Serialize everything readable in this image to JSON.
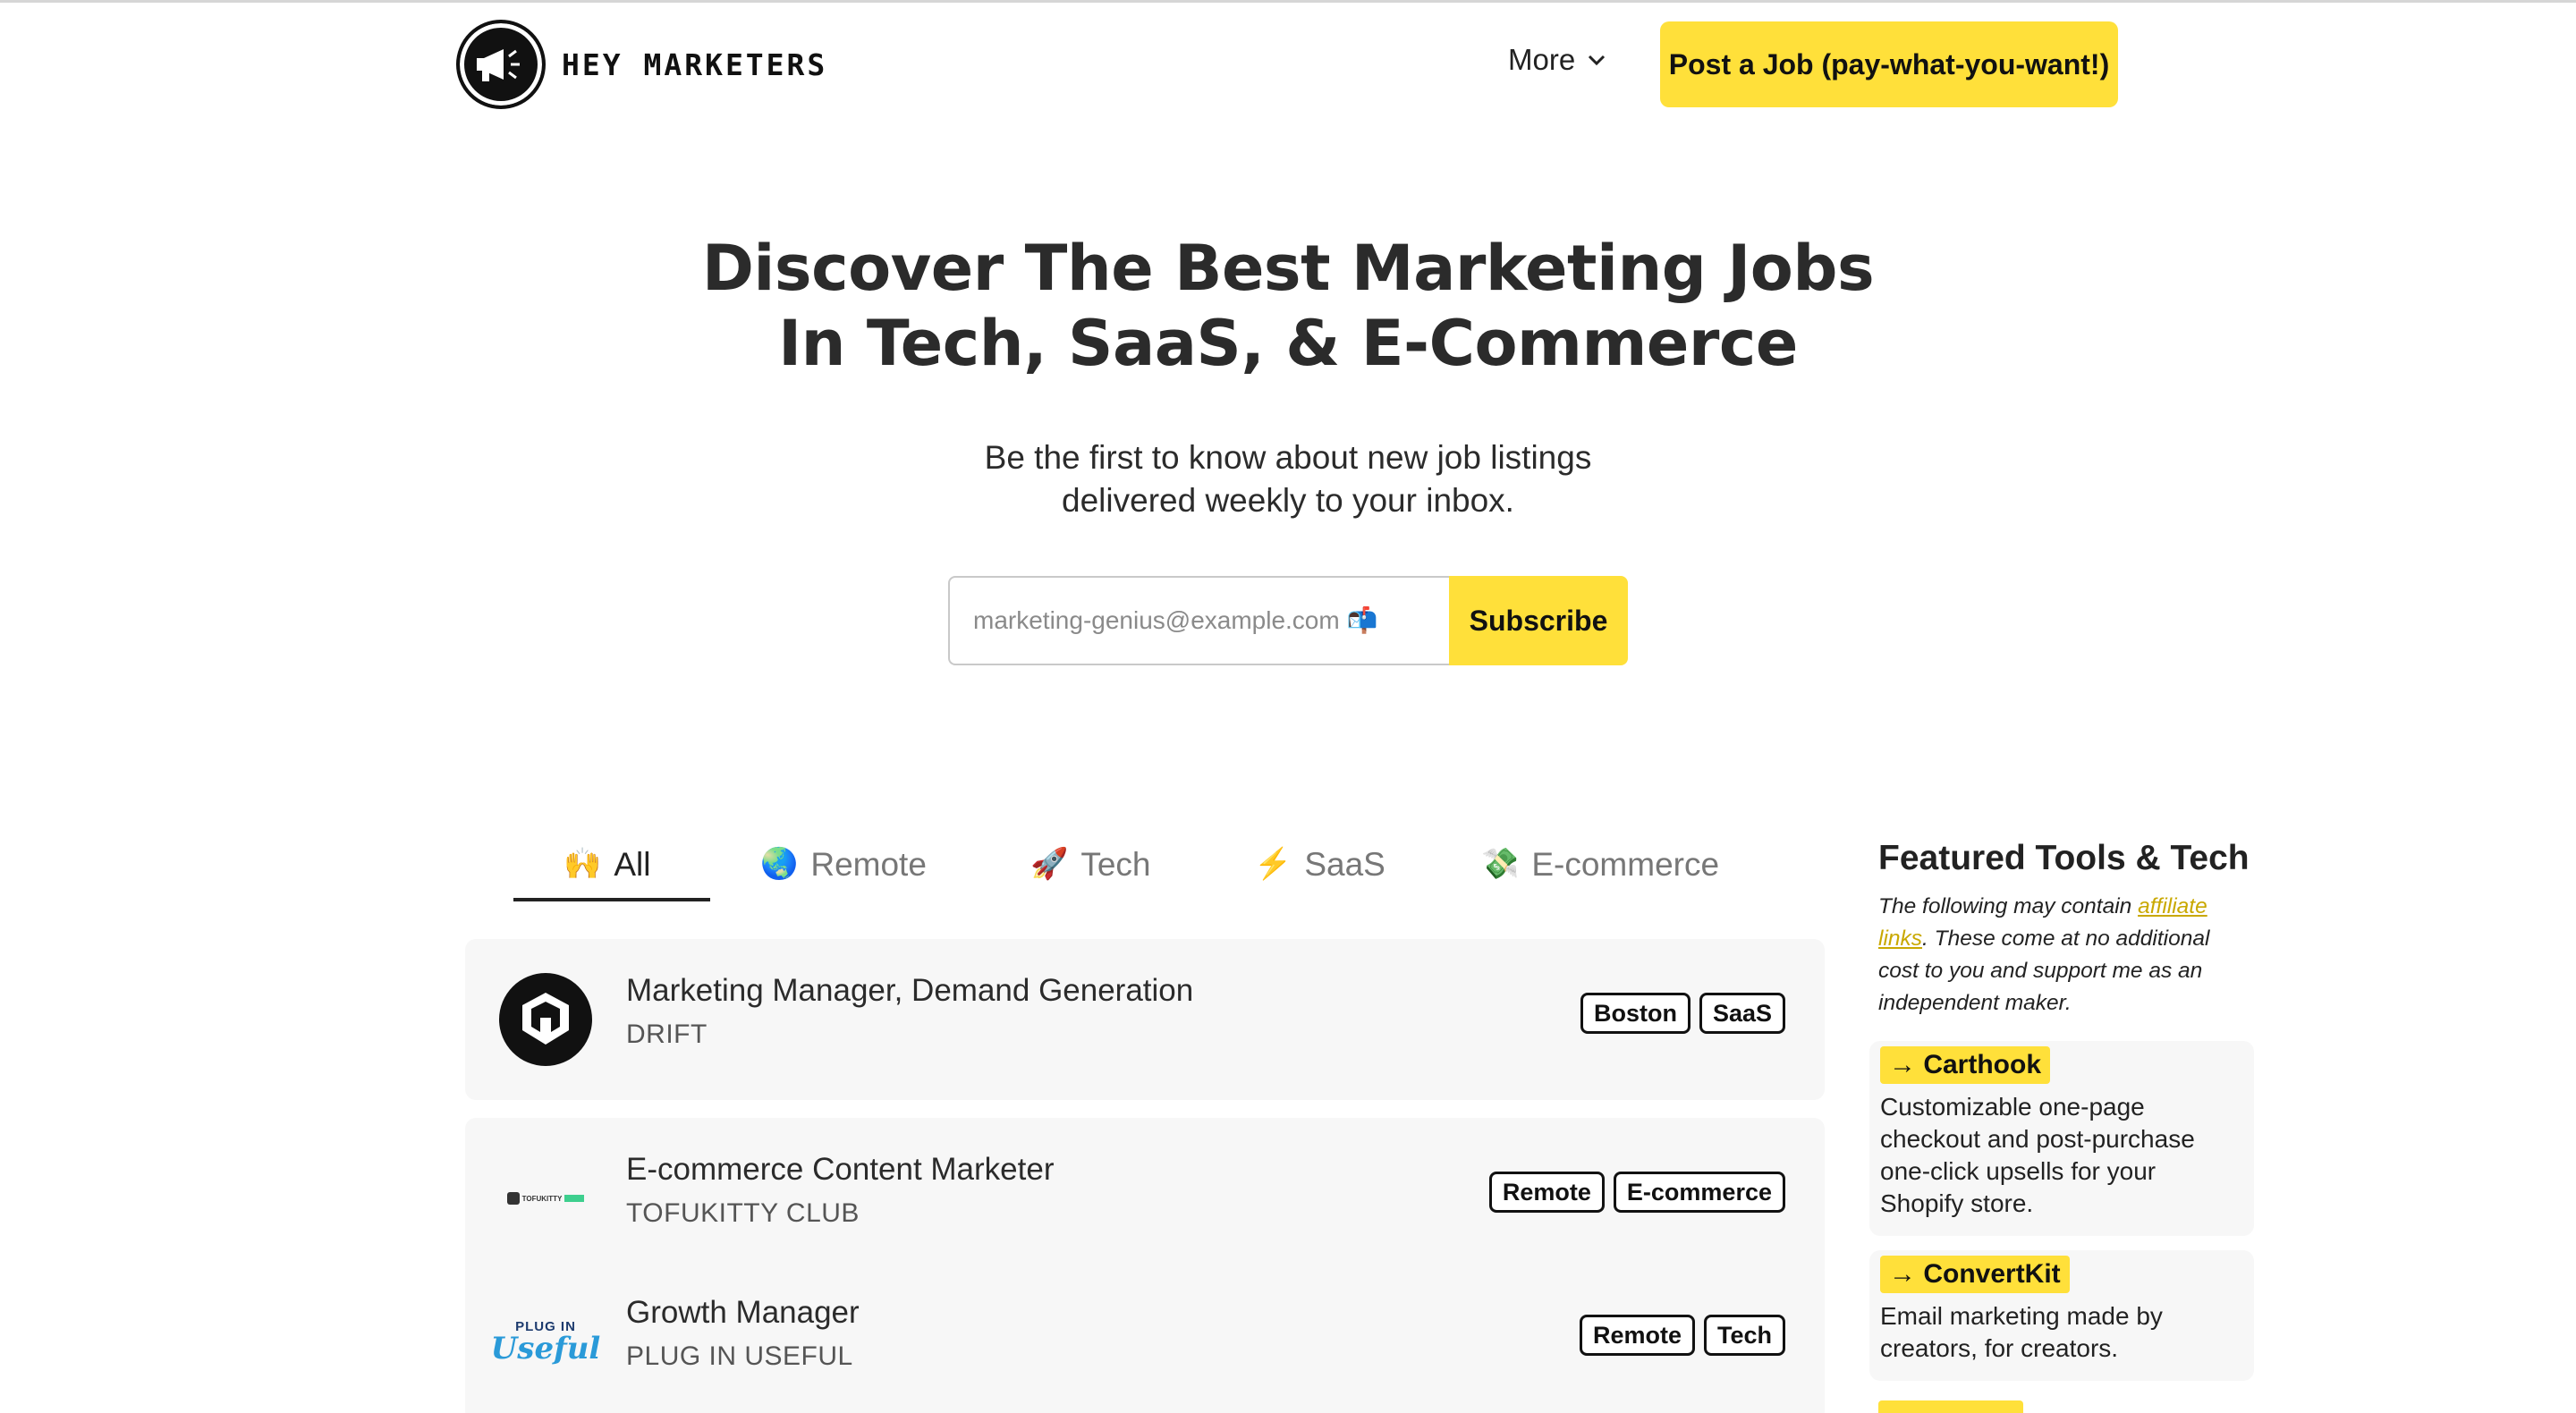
{
  "header": {
    "brand": "HEY MARKETERS",
    "nav_more": "More",
    "post_job": "Post a Job (pay-what-you-want!)"
  },
  "hero": {
    "title_line1": "Discover The Best Marketing Jobs",
    "title_line2": "In Tech, SaaS, & E-Commerce",
    "subtitle_line1": "Be the first to know about new job listings",
    "subtitle_line2": "delivered weekly to your inbox.",
    "email_placeholder": "marketing-genius@example.com 📬",
    "subscribe_label": "Subscribe"
  },
  "tabs": [
    {
      "emoji": "🙌",
      "label": "All",
      "active": true
    },
    {
      "emoji": "🌏",
      "label": "Remote"
    },
    {
      "emoji": "🚀",
      "label": "Tech"
    },
    {
      "emoji": "⚡",
      "label": "SaaS"
    },
    {
      "emoji": "💸",
      "label": "E-commerce"
    }
  ],
  "jobs": [
    {
      "title": "Marketing Manager, Demand Generation",
      "company": "DRIFT",
      "tags": [
        "Boston",
        "SaaS"
      ],
      "logo": "drift-logo"
    },
    {
      "title": "E-commerce Content Marketer",
      "company": "TOFUKITTY CLUB",
      "tags": [
        "Remote",
        "E-commerce"
      ],
      "logo": "tofukitty-logo",
      "logo_text": "TOFUKITTY"
    },
    {
      "title": "Growth Manager",
      "company": "PLUG IN USEFUL",
      "tags": [
        "Remote",
        "Tech"
      ],
      "logo": "plug-in-useful-logo",
      "logo_text_top": "PLUG IN",
      "logo_text_bottom": "Useful"
    }
  ],
  "sidebar": {
    "title": "Featured Tools & Tech",
    "note_before": "The following may contain ",
    "note_link": "affiliate links",
    "note_after": ". These come at no additional cost to you and support me as an independent maker.",
    "tools": [
      {
        "name": "→ Carthook",
        "desc": "Customizable one-page checkout and post-purchase one-click upsells for your Shopify store."
      },
      {
        "name": "→ ConvertKit",
        "desc": "Email marketing made by creators, for creators."
      }
    ]
  },
  "colors": {
    "accent": "#ffe03a",
    "card_bg": "#f7f7f7",
    "text": "#2b2b2b"
  }
}
